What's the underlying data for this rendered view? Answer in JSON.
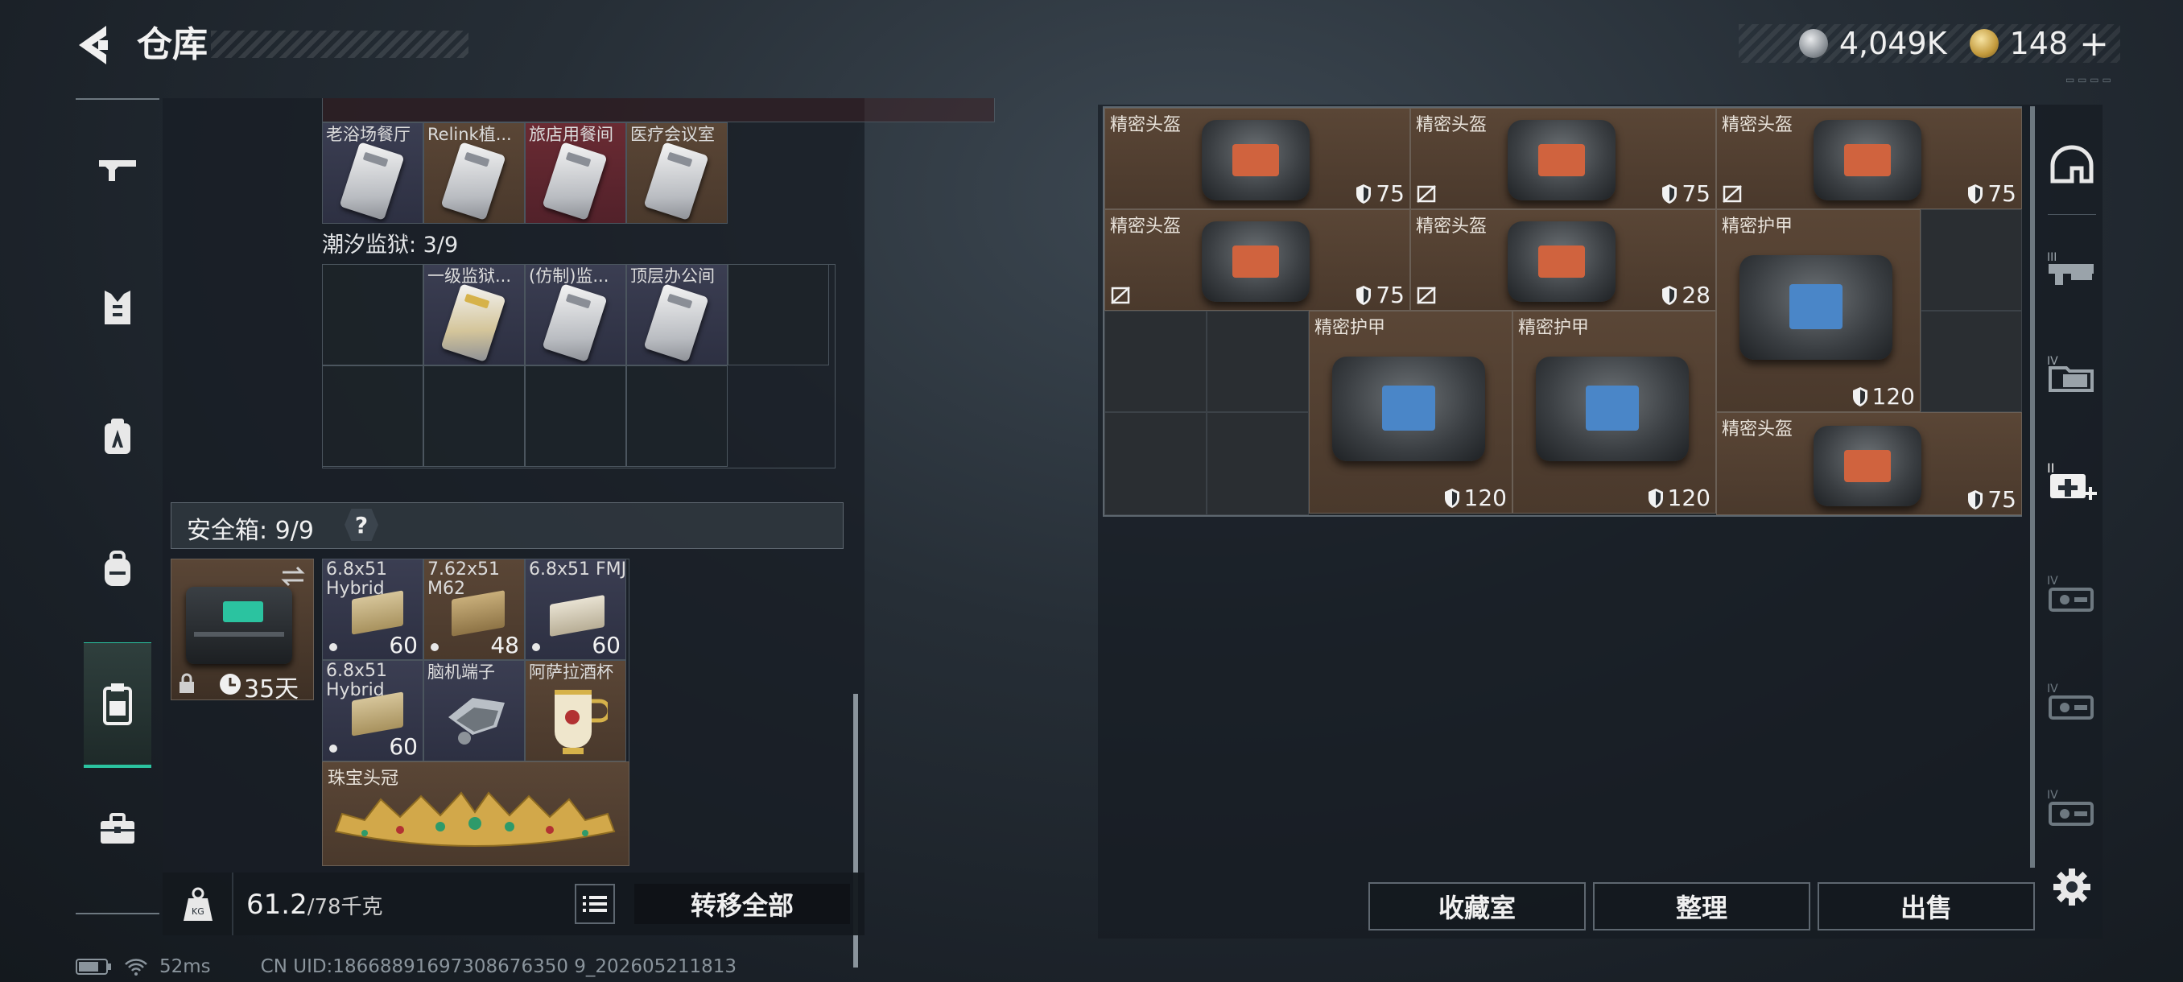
{
  "header": {
    "title": "仓库",
    "currency_silver": "4,049K",
    "currency_gold": "148",
    "add_label": "+"
  },
  "left_rail": {
    "items": [
      "weapon-tab",
      "armor-tab",
      "vest-tab",
      "backpack-tab",
      "container-tab",
      "toolbox-tab"
    ],
    "active": "container-tab"
  },
  "collection_top": {
    "items": [
      "老浴场餐厅",
      "Relink植...",
      "旅店用餐间",
      "医疗会议室"
    ]
  },
  "tide_prison": {
    "title": "潮汐监狱: 3/9",
    "items": [
      "一级监狱...",
      "(仿制)监...",
      "顶层办公间"
    ]
  },
  "safe_box": {
    "title": "安全箱: 9/9",
    "help": "?",
    "days": "35天",
    "items": [
      {
        "label": "6.8x51 Hybrid",
        "count": "60"
      },
      {
        "label": "7.62x51 M62",
        "count": "48"
      },
      {
        "label": "6.8x51 FMJ",
        "count": "60"
      },
      {
        "label": "6.8x51 Hybrid",
        "count": "60"
      },
      {
        "label": "脑机端子",
        "count": ""
      },
      {
        "label": "阿萨拉酒杯",
        "count": ""
      },
      {
        "label": "珠宝头冠",
        "count": ""
      }
    ]
  },
  "footer": {
    "weight": "61.2",
    "weight_max": "/78千克",
    "transfer_all": "转移全部"
  },
  "right_grid": {
    "items": [
      {
        "label": "精密头盔",
        "value": "75",
        "slash": false
      },
      {
        "label": "精密头盔",
        "value": "75",
        "slash": true
      },
      {
        "label": "精密头盔",
        "value": "75",
        "slash": true
      },
      {
        "label": "精密头盔",
        "value": "75",
        "slash": true
      },
      {
        "label": "精密头盔",
        "value": "28",
        "slash": true
      },
      {
        "label": "精密护甲",
        "value": "120",
        "slash": false
      },
      {
        "label": "精密护甲",
        "value": "120",
        "slash": false
      },
      {
        "label": "精密护甲",
        "value": "120",
        "slash": false
      },
      {
        "label": "精密头盔",
        "value": "75",
        "slash": false
      }
    ]
  },
  "right_buttons": {
    "collection": "收藏室",
    "sort": "整理",
    "sell": "出售"
  },
  "right_rail": {
    "items": [
      "helmet-tab",
      "III",
      "IV",
      "medkit-tab",
      "IV",
      "IV",
      "IV",
      "settings"
    ]
  },
  "status": {
    "ping": "52ms",
    "uid": "CN UID:18668891697308676350 9_202605211813"
  },
  "colors": {
    "accent_teal": "#2bc3a0",
    "item_brown": "#5a4636",
    "panel": "#181e25"
  }
}
